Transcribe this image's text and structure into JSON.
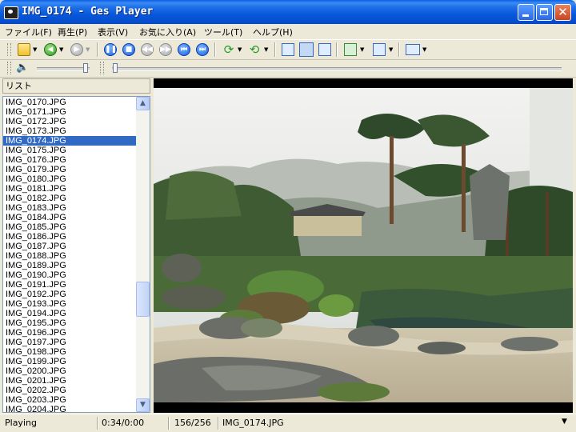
{
  "window": {
    "title": "IMG_0174 - Ges Player"
  },
  "menu": [
    "ファイル(F)",
    "再生(P)",
    "表示(V)",
    "お気に入り(A)",
    "ツール(T)",
    "ヘルプ(H)"
  ],
  "toolbar": {
    "icons": [
      "open-folder",
      "back",
      "forward",
      "pause",
      "stop",
      "previous",
      "next",
      "first",
      "last",
      "rotate",
      "refresh",
      "fit",
      "fullscreen",
      "pin",
      "slideshow",
      "screenshot",
      "display"
    ]
  },
  "list": {
    "header": "リスト",
    "items": [
      "IMG_0170.JPG",
      "IMG_0171.JPG",
      "IMG_0172.JPG",
      "IMG_0173.JPG",
      "IMG_0174.JPG",
      "IMG_0175.JPG",
      "IMG_0176.JPG",
      "IMG_0179.JPG",
      "IMG_0180.JPG",
      "IMG_0181.JPG",
      "IMG_0182.JPG",
      "IMG_0183.JPG",
      "IMG_0184.JPG",
      "IMG_0185.JPG",
      "IMG_0186.JPG",
      "IMG_0187.JPG",
      "IMG_0188.JPG",
      "IMG_0189.JPG",
      "IMG_0190.JPG",
      "IMG_0191.JPG",
      "IMG_0192.JPG",
      "IMG_0193.JPG",
      "IMG_0194.JPG",
      "IMG_0195.JPG",
      "IMG_0196.JPG",
      "IMG_0197.JPG",
      "IMG_0198.JPG",
      "IMG_0199.JPG",
      "IMG_0200.JPG",
      "IMG_0201.JPG",
      "IMG_0202.JPG",
      "IMG_0203.JPG",
      "IMG_0204.JPG"
    ],
    "selected_index": 4
  },
  "status": {
    "state": "Playing",
    "time": "0:34/0:00",
    "position": "156/256",
    "filename": "IMG_0174.JPG"
  },
  "colors": {
    "titlebar": "#0858dc",
    "selection": "#316ac5",
    "face": "#ece9d8"
  }
}
